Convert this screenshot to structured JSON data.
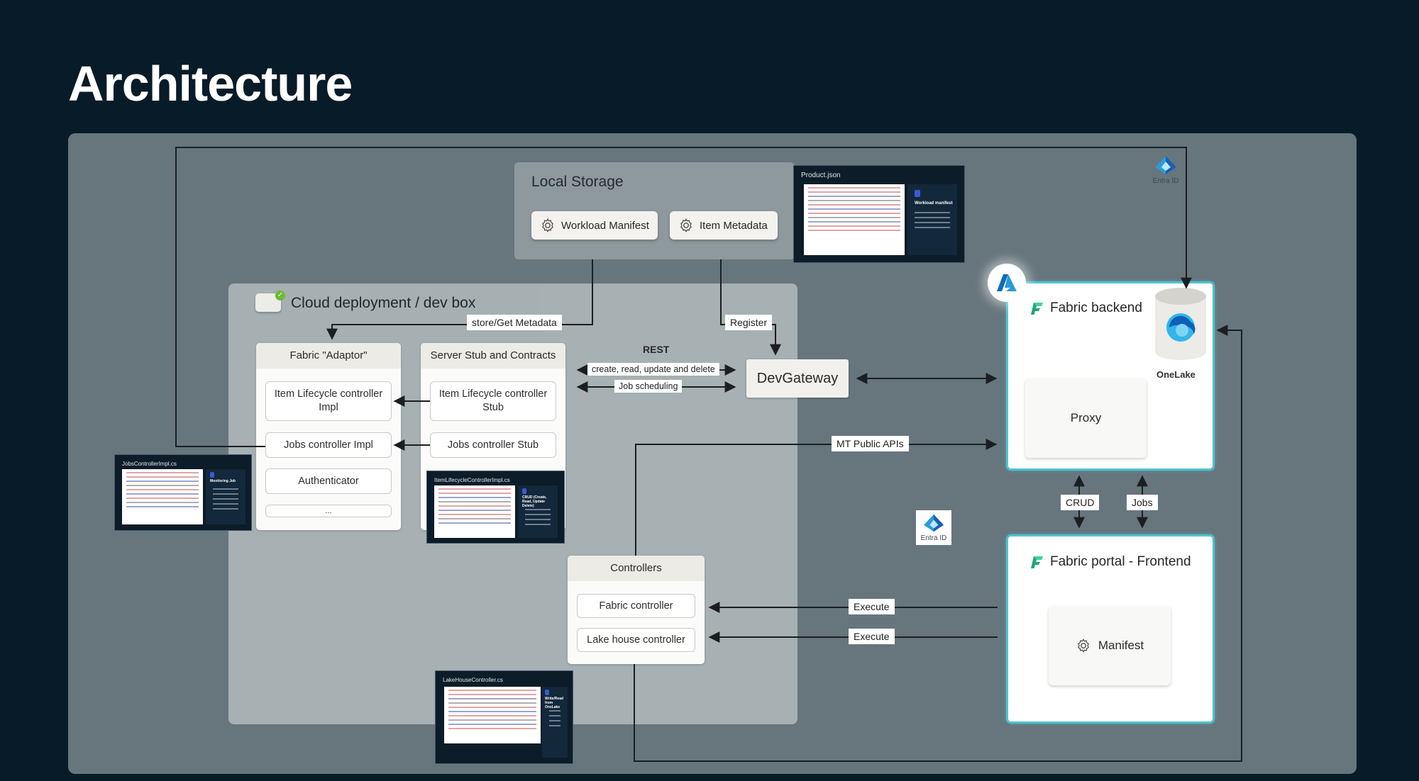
{
  "slide": {
    "title": "Architecture"
  },
  "local_storage": {
    "title": "Local Storage",
    "items": [
      {
        "label": "Workload Manifest",
        "icon": "gear-icon"
      },
      {
        "label": "Item Metadata",
        "icon": "gear-icon"
      }
    ]
  },
  "code_cards": {
    "product_json": {
      "title": "Product.json",
      "heading": "Workload manifest"
    },
    "jobs_controller": {
      "title": "JobsControllerImpl.cs",
      "heading": "Monitoring Job"
    },
    "item_lifecycle": {
      "title": "ItemLifecycleControllerImpl.cs",
      "heading": "CRUD (Create, Read, Update Delete)"
    },
    "lakehouse": {
      "title": "LakeHouseController.cs",
      "heading": "Write/Read from OneLake"
    }
  },
  "devbox": {
    "title": "Cloud deployment / dev box",
    "adaptor": {
      "title": "Fabric \"Adaptor\"",
      "items": [
        "Item Lifecycle controller Impl",
        "Jobs controller Impl",
        "Authenticator",
        "..."
      ]
    },
    "stub": {
      "title": "Server Stub and Contracts",
      "items": [
        "Item Lifecycle controller Stub",
        "Jobs controller Stub"
      ]
    },
    "controllers": {
      "title": "Controllers",
      "items": [
        "Fabric controller",
        "Lake house controller"
      ]
    },
    "devgateway": "DevGateway"
  },
  "connectors": {
    "store_get_metadata": "store/Get Metadata",
    "register": "Register",
    "rest": "REST",
    "crud": "create, read, update and delete",
    "job_scheduling": "Job scheduling",
    "mt_public_apis": "MT Public APIs",
    "execute_1": "Execute",
    "execute_2": "Execute",
    "crud_short": "CRUD",
    "jobs": "Jobs"
  },
  "fabric_backend": {
    "title": "Fabric backend",
    "proxy": "Proxy",
    "onelake": "OneLake"
  },
  "fabric_frontend": {
    "title": "Fabric portal - Frontend",
    "manifest": "Manifest"
  },
  "entra": {
    "label_top": "Entra ID",
    "label_mid": "Entra ID"
  },
  "colors": {
    "background": "#071b28",
    "canvas": "#67767d",
    "accent_cyan": "#4fc3d2",
    "fabric_green": "#1fa67a",
    "azure_blue": "#0f6cbd"
  }
}
